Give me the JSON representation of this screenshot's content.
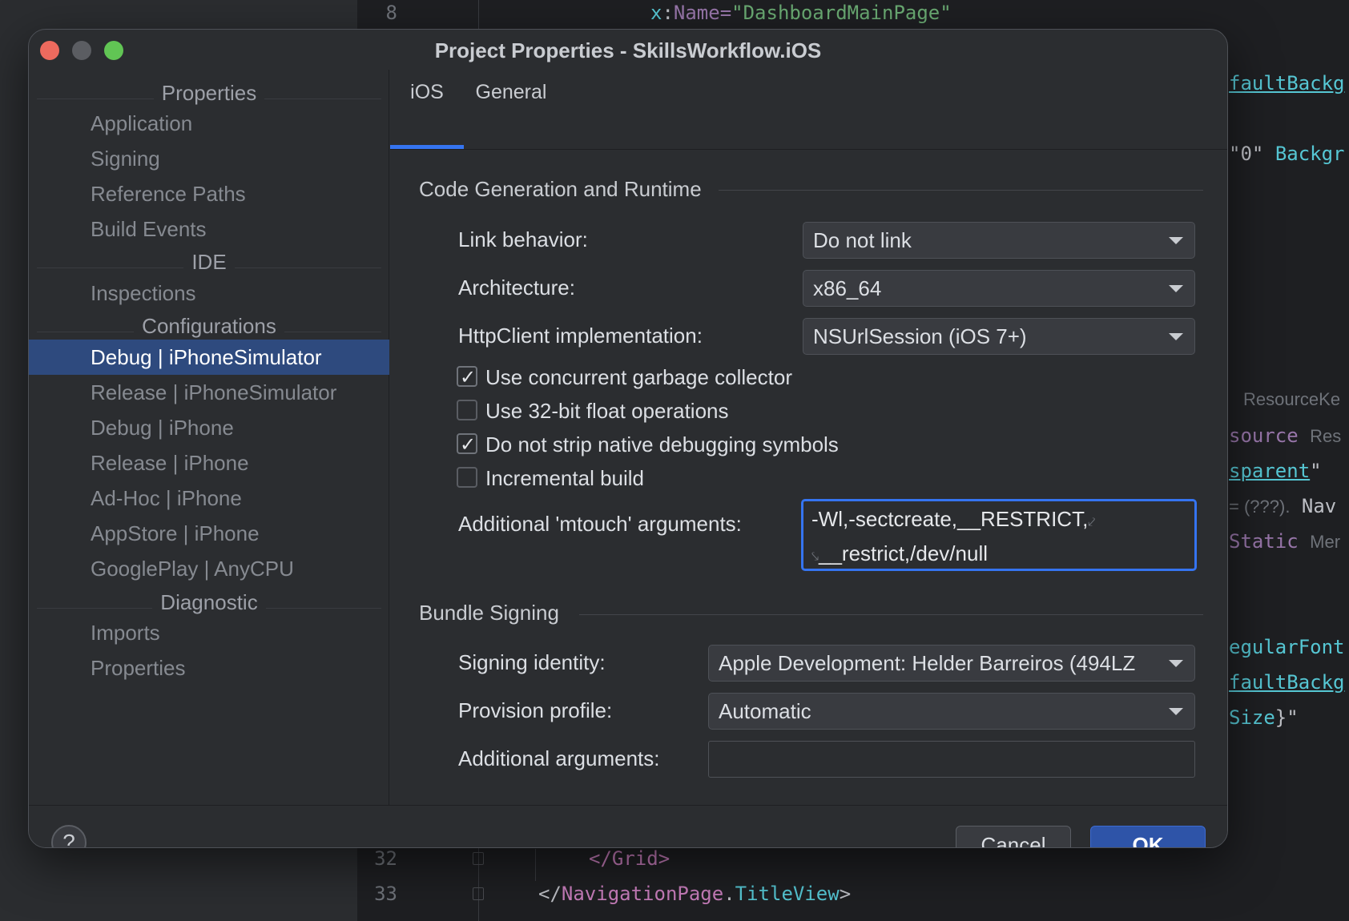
{
  "editor": {
    "lines": [
      {
        "num": "8",
        "code_attr": "x",
        "code_rest": "Name=",
        "code_val": "\"DashboardMainPage\""
      },
      {
        "num": "32",
        "code": "</Grid>"
      },
      {
        "num": "33",
        "code_pre": "</",
        "code_tag": "NavigationPage",
        "code_dot": ".",
        "code_prop": "TitleView",
        "code_end": ">"
      }
    ],
    "right_fragments": {
      "f1": "faultBackg",
      "f2a": "\"0\"",
      "f2b": "Backgr",
      "f3": "ResourceKe",
      "f4a": "source",
      "f4b": "Res",
      "f5a": "sparent",
      "f5b": "\"",
      "f6a": "= (???).",
      "f6b": "Nav",
      "f7a": "Static",
      "f7b": "Mer",
      "f8": "egularFont",
      "f9": "faultBackg",
      "f10a": "Size",
      "f10b": "}\""
    }
  },
  "dialog": {
    "title": "Project Properties - SkillsWorkflow.iOS",
    "colors": {
      "close": "#ed6a5e",
      "minimize": "#5b5d62",
      "zoom": "#61c554",
      "accent": "#3574f0",
      "selection": "#2e4a7e"
    },
    "sidebar": {
      "headers": [
        "Properties",
        "IDE",
        "Configurations",
        "Diagnostic"
      ],
      "properties_items": [
        "Application",
        "Signing",
        "Reference Paths",
        "Build Events"
      ],
      "ide_items": [
        "Inspections"
      ],
      "config_items": [
        "Debug | iPhoneSimulator",
        "Release | iPhoneSimulator",
        "Debug | iPhone",
        "Release | iPhone",
        "Ad-Hoc | iPhone",
        "AppStore | iPhone",
        "GooglePlay | AnyCPU"
      ],
      "diagnostic_items": [
        "Imports",
        "Properties"
      ],
      "selected": "Debug | iPhoneSimulator"
    },
    "tabs": [
      "iOS",
      "General"
    ],
    "active_tab": "iOS",
    "code_gen": {
      "title": "Code Generation and Runtime",
      "link_behavior_label": "Link behavior:",
      "link_behavior_value": "Do not link",
      "architecture_label": "Architecture:",
      "architecture_value": "x86_64",
      "httpclient_label": "HttpClient implementation:",
      "httpclient_value": "NSUrlSession (iOS 7+)",
      "checks": [
        {
          "label": "Use concurrent garbage collector",
          "checked": true
        },
        {
          "label": "Use 32-bit float operations",
          "checked": false
        },
        {
          "label": "Do not strip native debugging symbols",
          "checked": true
        },
        {
          "label": "Incremental build",
          "checked": false
        }
      ],
      "mtouch_label": "Additional 'mtouch' arguments:",
      "mtouch_line1": "-Wl,-sectcreate,__RESTRICT,",
      "mtouch_line2": "__restrict,/dev/null"
    },
    "bundle_signing": {
      "title": "Bundle Signing",
      "identity_label": "Signing identity:",
      "identity_value": "Apple Development: Helder Barreiros (494LZ",
      "profile_label": "Provision profile:",
      "profile_value": "Automatic",
      "args_label": "Additional arguments:",
      "args_value": ""
    },
    "footer": {
      "help": "?",
      "cancel": "Cancel",
      "ok": "OK"
    }
  }
}
